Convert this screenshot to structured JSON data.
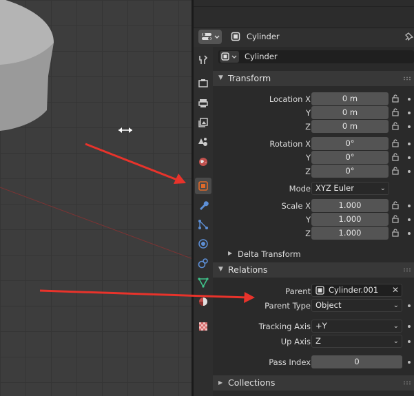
{
  "header": {
    "object_name": "Cylinder",
    "pin_icon": "pin-icon",
    "editor_type_icon": "properties-editor-icon"
  },
  "object_selector": {
    "value": "Cylinder"
  },
  "tabs": [
    {
      "name": "tool",
      "icon": "tool-icon"
    },
    {
      "name": "render",
      "icon": "render-icon"
    },
    {
      "name": "output",
      "icon": "output-icon"
    },
    {
      "name": "view-layer",
      "icon": "view-layer-icon"
    },
    {
      "name": "scene",
      "icon": "scene-icon"
    },
    {
      "name": "world",
      "icon": "world-icon"
    },
    {
      "name": "object",
      "icon": "object-icon",
      "active": true
    },
    {
      "name": "modifiers",
      "icon": "wrench-icon"
    },
    {
      "name": "particles",
      "icon": "particles-icon"
    },
    {
      "name": "physics",
      "icon": "physics-icon"
    },
    {
      "name": "constraints",
      "icon": "constraints-icon"
    },
    {
      "name": "data",
      "icon": "mesh-data-icon"
    },
    {
      "name": "material",
      "icon": "material-icon"
    },
    {
      "name": "texture",
      "icon": "texture-icon"
    }
  ],
  "transform": {
    "title": "Transform",
    "location": {
      "x_label": "Location X",
      "y_label": "Y",
      "z_label": "Z",
      "x": "0 m",
      "y": "0 m",
      "z": "0 m"
    },
    "rotation": {
      "x_label": "Rotation X",
      "y_label": "Y",
      "z_label": "Z",
      "x": "0°",
      "y": "0°",
      "z": "0°"
    },
    "mode": {
      "label": "Mode",
      "value": "XYZ Euler"
    },
    "scale": {
      "x_label": "Scale X",
      "y_label": "Y",
      "z_label": "Z",
      "x": "1.000",
      "y": "1.000",
      "z": "1.000"
    },
    "delta_title": "Delta Transform"
  },
  "relations": {
    "title": "Relations",
    "parent": {
      "label": "Parent",
      "value": "Cylinder.001"
    },
    "parent_type": {
      "label": "Parent Type",
      "value": "Object"
    },
    "tracking_axis": {
      "label": "Tracking Axis",
      "value": "+Y"
    },
    "up_axis": {
      "label": "Up Axis",
      "value": "Z"
    },
    "pass_index": {
      "label": "Pass Index",
      "value": "0"
    }
  },
  "collections": {
    "title": "Collections"
  },
  "colors": {
    "accent": "#e06a2a",
    "arrow": "#e8332b",
    "panel_bg": "#2a2a2a",
    "field_bg": "#545454"
  }
}
